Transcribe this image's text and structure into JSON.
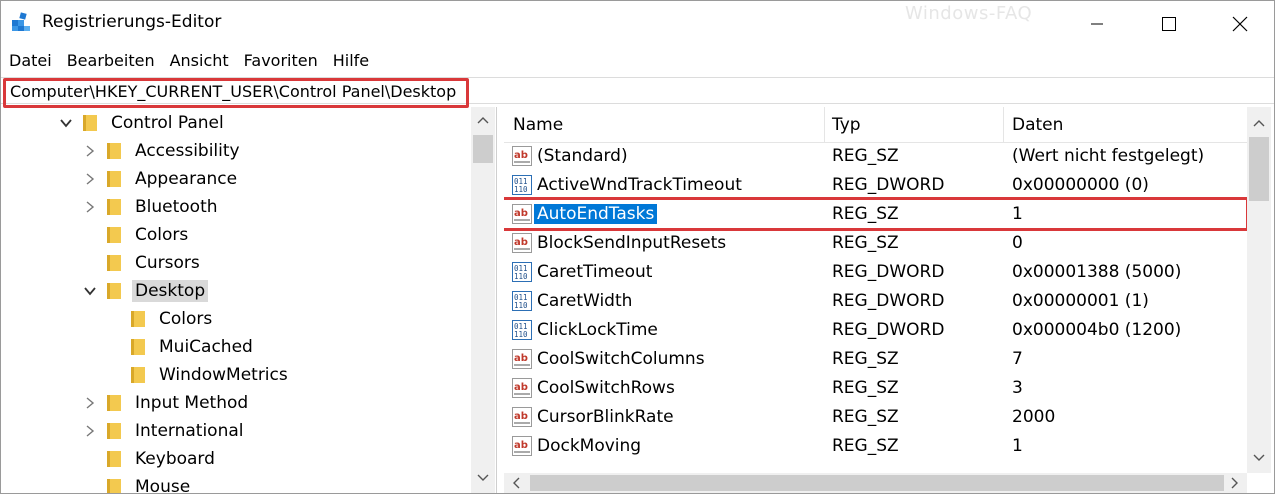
{
  "window": {
    "title": "Registrierungs-Editor",
    "watermark": "Windows-FAQ"
  },
  "menu": [
    "Datei",
    "Bearbeiten",
    "Ansicht",
    "Favoriten",
    "Hilfe"
  ],
  "address": "Computer\\HKEY_CURRENT_USER\\Control Panel\\Desktop",
  "tree": {
    "items": [
      {
        "label": "Control Panel",
        "expanded": true,
        "level": 0
      },
      {
        "label": "Accessibility",
        "expanded": false,
        "level": 1
      },
      {
        "label": "Appearance",
        "expanded": false,
        "level": 1
      },
      {
        "label": "Bluetooth",
        "expanded": false,
        "level": 1
      },
      {
        "label": "Colors",
        "expanded": null,
        "level": 1
      },
      {
        "label": "Cursors",
        "expanded": null,
        "level": 1
      },
      {
        "label": "Desktop",
        "expanded": true,
        "level": 1,
        "selected": true
      },
      {
        "label": "Colors",
        "expanded": null,
        "level": 2
      },
      {
        "label": "MuiCached",
        "expanded": null,
        "level": 2
      },
      {
        "label": "WindowMetrics",
        "expanded": null,
        "level": 2
      },
      {
        "label": "Input Method",
        "expanded": false,
        "level": 1
      },
      {
        "label": "International",
        "expanded": false,
        "level": 1
      },
      {
        "label": "Keyboard",
        "expanded": null,
        "level": 1
      },
      {
        "label": "Mouse",
        "expanded": null,
        "level": 1
      }
    ]
  },
  "list": {
    "columns": [
      "Name",
      "Typ",
      "Daten"
    ],
    "rows": [
      {
        "name": "(Standard)",
        "type": "REG_SZ",
        "data": "(Wert nicht festgelegt)",
        "icon": "string-value-icon"
      },
      {
        "name": "ActiveWndTrackTimeout",
        "type": "REG_DWORD",
        "data": "0x00000000 (0)",
        "icon": "binary-value-icon"
      },
      {
        "name": "AutoEndTasks",
        "type": "REG_SZ",
        "data": "1",
        "icon": "string-value-icon",
        "selected": true
      },
      {
        "name": "BlockSendInputResets",
        "type": "REG_SZ",
        "data": "0",
        "icon": "string-value-icon"
      },
      {
        "name": "CaretTimeout",
        "type": "REG_DWORD",
        "data": "0x00001388 (5000)",
        "icon": "binary-value-icon"
      },
      {
        "name": "CaretWidth",
        "type": "REG_DWORD",
        "data": "0x00000001 (1)",
        "icon": "binary-value-icon"
      },
      {
        "name": "ClickLockTime",
        "type": "REG_DWORD",
        "data": "0x000004b0 (1200)",
        "icon": "binary-value-icon"
      },
      {
        "name": "CoolSwitchColumns",
        "type": "REG_SZ",
        "data": "7",
        "icon": "string-value-icon"
      },
      {
        "name": "CoolSwitchRows",
        "type": "REG_SZ",
        "data": "3",
        "icon": "string-value-icon"
      },
      {
        "name": "CursorBlinkRate",
        "type": "REG_SZ",
        "data": "2000",
        "icon": "string-value-icon"
      },
      {
        "name": "DockMoving",
        "type": "REG_SZ",
        "data": "1",
        "icon": "string-value-icon"
      }
    ]
  },
  "colors": {
    "highlight_red": "#d9383a",
    "selection_blue": "#0078d7",
    "folder_yellow": "#f3c94f"
  }
}
